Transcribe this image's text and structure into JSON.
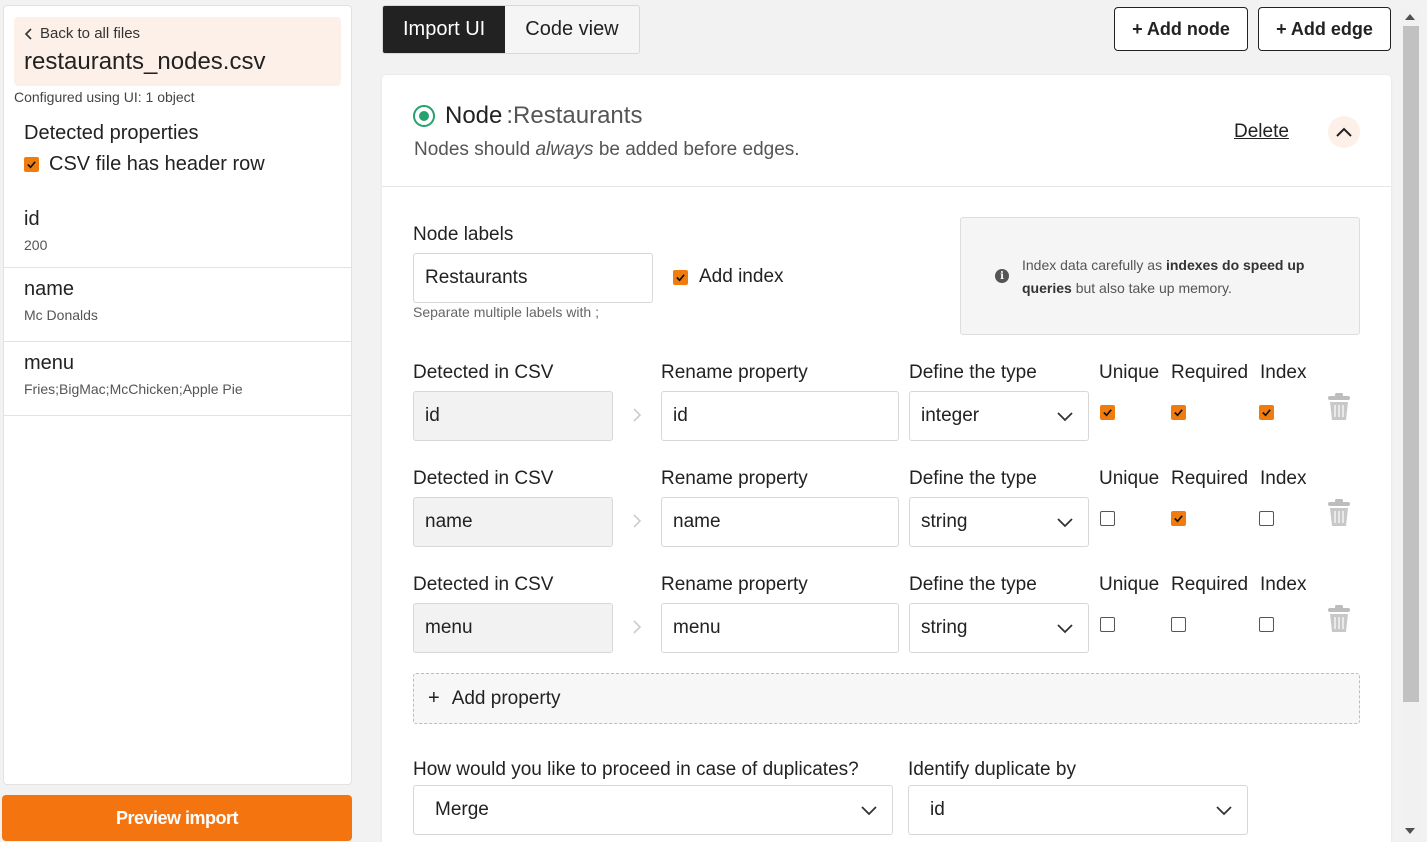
{
  "sidebar": {
    "back_label": "Back to all files",
    "file_name": "restaurants_nodes.csv",
    "configured": "Configured using UI: 1 object",
    "detected_title": "Detected properties",
    "header_row_label": "CSV file has header row",
    "header_row_checked": true,
    "properties": [
      {
        "name": "id",
        "sample": "200"
      },
      {
        "name": "name",
        "sample": "Mc Donalds"
      },
      {
        "name": "menu",
        "sample": "Fries;BigMac;McChicken;Apple Pie"
      }
    ],
    "preview_button": "Preview import"
  },
  "tabs": [
    {
      "label": "Import UI",
      "active": true
    },
    {
      "label": "Code view",
      "active": false
    }
  ],
  "toolbar": {
    "add_node": "+ Add node",
    "add_edge": "+ Add edge"
  },
  "node": {
    "title_word": "Node",
    "title_name": ":Restaurants",
    "subtitle_pre": "Nodes should ",
    "subtitle_em": "always",
    "subtitle_post": " be added before edges.",
    "delete_label": "Delete",
    "labels_title": "Node labels",
    "labels_value": "Restaurants",
    "labels_hint": "Separate multiple labels with ;",
    "add_index_label": "Add index",
    "add_index_checked": true,
    "info_pre": "Index data carefully as ",
    "info_bold": "indexes do speed up queries",
    "info_post": " but also take up memory.",
    "columns": {
      "detected": "Detected in CSV",
      "rename": "Rename property",
      "type": "Define the type",
      "unique": "Unique",
      "required": "Required",
      "index": "Index"
    },
    "rows": [
      {
        "detected": "id",
        "rename": "id",
        "type": "integer",
        "unique": true,
        "required": true,
        "index": true
      },
      {
        "detected": "name",
        "rename": "name",
        "type": "string",
        "unique": false,
        "required": true,
        "index": false
      },
      {
        "detected": "menu",
        "rename": "menu",
        "type": "string",
        "unique": false,
        "required": false,
        "index": false
      }
    ],
    "add_property": "Add property",
    "duplicates_title": "How would you like to proceed in case of duplicates?",
    "duplicates_value": "Merge",
    "identify_title": "Identify duplicate by",
    "identify_value": "id"
  },
  "colors": {
    "accent": "#f47410",
    "status_green": "#23a26d",
    "tab_active": "#222222"
  }
}
